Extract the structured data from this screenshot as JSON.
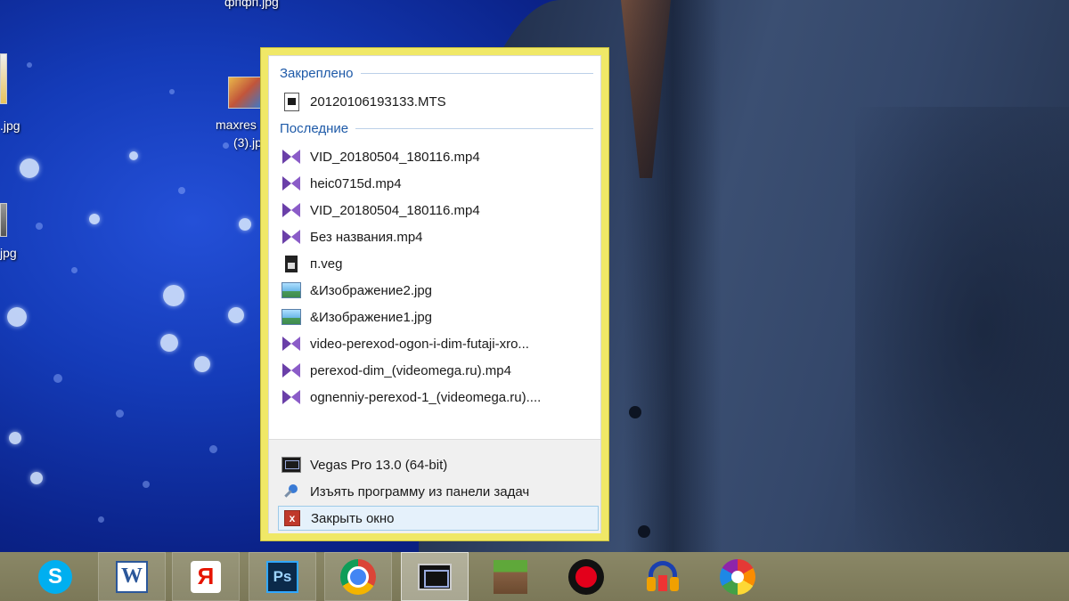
{
  "desktop": {
    "icons": [
      {
        "label": "фпфп.jpg"
      },
      {
        "label": ".jpg"
      },
      {
        "label": "maxres"
      },
      {
        "label": "(3).jp"
      },
      {
        "label": "jpg"
      }
    ]
  },
  "jump_list": {
    "pinned_header": "Закреплено",
    "pinned_items": [
      {
        "label": "20120106193133.MTS",
        "icon": "mts-file-icon"
      }
    ],
    "recent_header": "Последние",
    "recent_items": [
      {
        "label": "VID_20180504_180116.mp4",
        "icon": "vegas-file-icon"
      },
      {
        "label": "heic0715d.mp4",
        "icon": "vegas-file-icon"
      },
      {
        "label": "VID_20180504_180116.mp4",
        "icon": "vegas-file-icon"
      },
      {
        "label": "Без названия.mp4",
        "icon": "vegas-file-icon"
      },
      {
        "label": "п.veg",
        "icon": "veg-file-icon"
      },
      {
        "label": "&Изображение2.jpg",
        "icon": "image-file-icon"
      },
      {
        "label": "&Изображение1.jpg",
        "icon": "image-file-icon"
      },
      {
        "label": "video-perexod-ogon-i-dim-futaji-xro...",
        "icon": "vegas-file-icon"
      },
      {
        "label": "perexod-dim_(videomega.ru).mp4",
        "icon": "vegas-file-icon"
      },
      {
        "label": "ognenniy-perexod-1_(videomega.ru)....",
        "icon": "vegas-file-icon"
      }
    ],
    "tasks": {
      "app_name": "Vegas Pro 13.0 (64-bit)",
      "unpin": "Изъять программу из панели задач",
      "close": "Закрыть окно"
    },
    "close_icon_glyph": "x"
  },
  "taskbar": {
    "word_letter": "W",
    "yandex_letter": "Я",
    "photoshop_label": "Ps",
    "skype_letter": "S",
    "items": [
      {
        "name": "skype",
        "icon": "skype-icon"
      },
      {
        "name": "word",
        "icon": "word-icon"
      },
      {
        "name": "yandex-browser",
        "icon": "yandex-icon"
      },
      {
        "name": "photoshop",
        "icon": "photoshop-icon"
      },
      {
        "name": "chrome",
        "icon": "chrome-icon"
      },
      {
        "name": "vegas-pro",
        "icon": "vegas-pro-icon"
      },
      {
        "name": "minecraft",
        "icon": "minecraft-icon"
      },
      {
        "name": "record",
        "icon": "record-icon"
      },
      {
        "name": "audacity",
        "icon": "audacity-icon"
      },
      {
        "name": "picasa",
        "icon": "picasa-icon"
      }
    ]
  },
  "colors": {
    "jump_list_border": "#f0e867",
    "section_header": "#1e5aa8",
    "taskbar": "#8a8766"
  }
}
